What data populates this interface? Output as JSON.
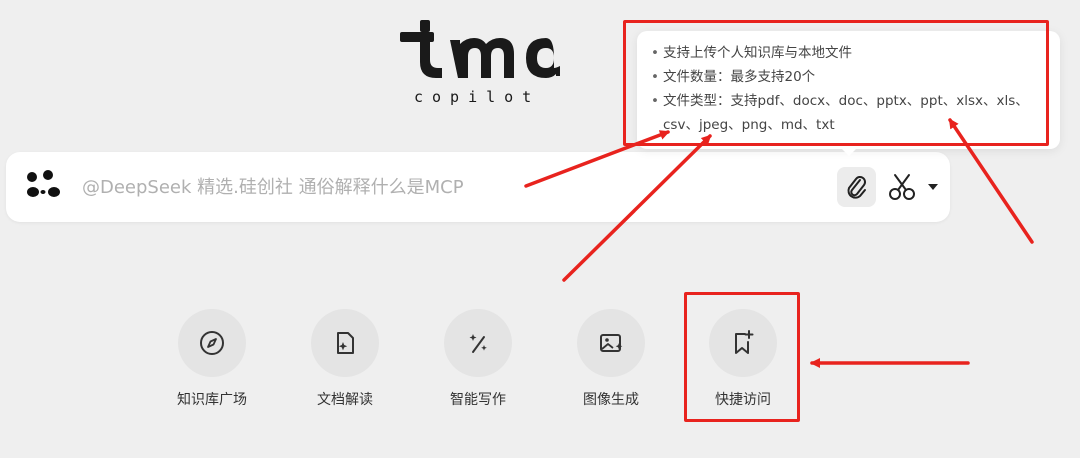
{
  "logo": {
    "subtitle": "copilot"
  },
  "search": {
    "placeholder": "@DeepSeek 精选.硅创社 通俗解释什么是MCP",
    "icons": [
      "panda-icon",
      "paperclip-icon",
      "scissors-icon",
      "caret-down-icon"
    ]
  },
  "tooltip": {
    "items": [
      "支持上传个人知识库与本地文件",
      "文件数量：最多支持20个",
      "文件类型：支持pdf、docx、doc、pptx、ppt、xlsx、xls、csv、jpeg、png、md、txt"
    ]
  },
  "actions": [
    {
      "label": "知识库广场",
      "icon": "compass-icon"
    },
    {
      "label": "文档解读",
      "icon": "document-sparkle-icon"
    },
    {
      "label": "智能写作",
      "icon": "magic-wand-icon"
    },
    {
      "label": "图像生成",
      "icon": "image-sparkle-icon"
    },
    {
      "label": "快捷访问",
      "icon": "bookmark-plus-icon"
    }
  ],
  "colors": {
    "annotation": "#e8231e",
    "background": "#efefef",
    "circle": "#e4e4e4"
  }
}
